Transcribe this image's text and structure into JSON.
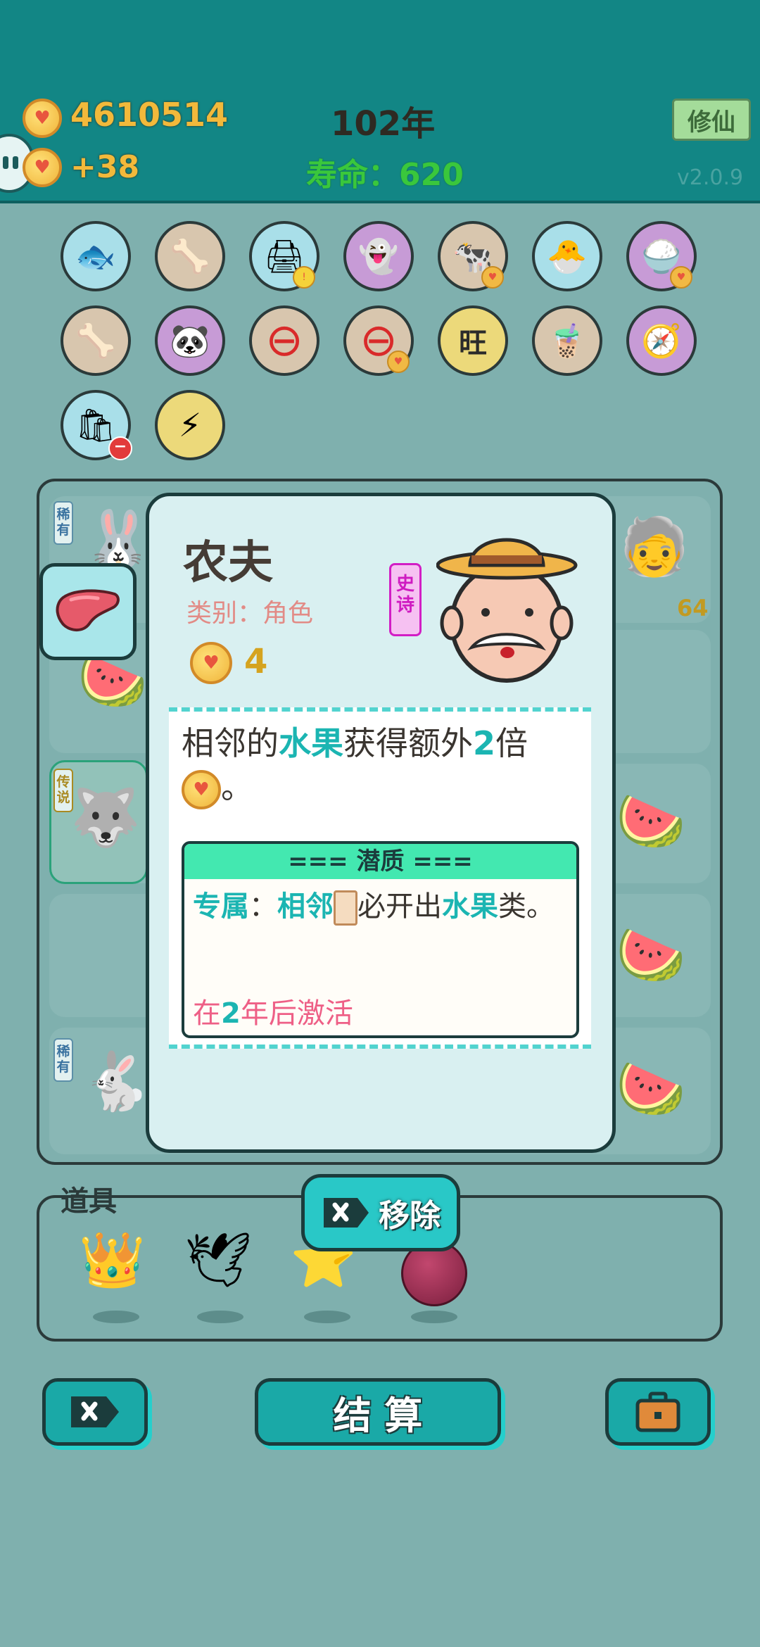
{
  "header": {
    "coins": "4610514",
    "income": "+38",
    "year": "102年",
    "lifespan_label": "寿命：620",
    "cultivate_button": "修仙",
    "version": "v2.0.9"
  },
  "items_row": [
    {
      "name": "fishbowl-icon",
      "glyph": "🐟",
      "bg": "#a9dfe9"
    },
    {
      "name": "pet-food-bowl-icon",
      "glyph": "🦴",
      "bg": "#d8c6ae"
    },
    {
      "name": "printer-icon",
      "glyph": "🖨",
      "bg": "#a9dfe9"
    },
    {
      "name": "ghost-icon",
      "glyph": "👻",
      "bg": "#c79bd6"
    },
    {
      "name": "cow-pair-icon",
      "glyph": "🐄",
      "bg": "#d8c6ae"
    },
    {
      "name": "chick-egg-icon",
      "glyph": "🐣",
      "bg": "#a9dfe9"
    },
    {
      "name": "rice-bowl-icon",
      "glyph": "🍚",
      "bg": "#c79bd6"
    },
    {
      "name": "dog-food-bowl-icon",
      "glyph": "🦴",
      "bg": "#d8c6ae"
    },
    {
      "name": "panda-icon",
      "glyph": "🐼",
      "bg": "#c79bd6"
    },
    {
      "name": "no-entry-icon",
      "glyph": "⊖",
      "bg": "#d8c6ae"
    },
    {
      "name": "no-entry-icon",
      "glyph": "⊖",
      "bg": "#d8c6ae"
    },
    {
      "name": "wang-tiles-icon",
      "glyph": "旺",
      "bg": "#ecd97a"
    },
    {
      "name": "bubble-tea-icon",
      "glyph": "🧋",
      "bg": "#d8c6ae"
    },
    {
      "name": "compass-icon",
      "glyph": "🧭",
      "bg": "#c79bd6"
    },
    {
      "name": "garbage-bag-icon",
      "glyph": "🛍",
      "bg": "#a9dfe9"
    },
    {
      "name": "lightning-icon",
      "glyph": "⚡",
      "bg": "#ecd97a"
    }
  ],
  "board": {
    "rarity_rare": "稀有",
    "rarity_legend": "传说",
    "value_64": "64"
  },
  "card": {
    "title": "农夫",
    "category": "类别：角色",
    "rarity": "史诗",
    "value": "4",
    "desc_part1": "相邻的",
    "desc_hl1": "水果",
    "desc_part2": "获得额外",
    "desc_hl2": "2",
    "desc_part3": "倍",
    "desc_end": "。",
    "potential_header": "=== 潜质 ===",
    "pot_hl1": "专属",
    "pot_colon": "：",
    "pot_hl2": "相邻",
    "pot_part": "必开出",
    "pot_hl3": "水果",
    "pot_end": "类。",
    "activate_prefix": "在",
    "activate_num": "2",
    "activate_suffix": "年后激活"
  },
  "remove_button": "移除",
  "tools": {
    "label": "道具"
  },
  "bottom": {
    "settle": "结 算"
  },
  "colors": {
    "header_bg": "#128685",
    "accent_teal": "#1bb5b2",
    "epic_pink": "#cf1bc1",
    "activate_pink": "#ee5f86"
  }
}
